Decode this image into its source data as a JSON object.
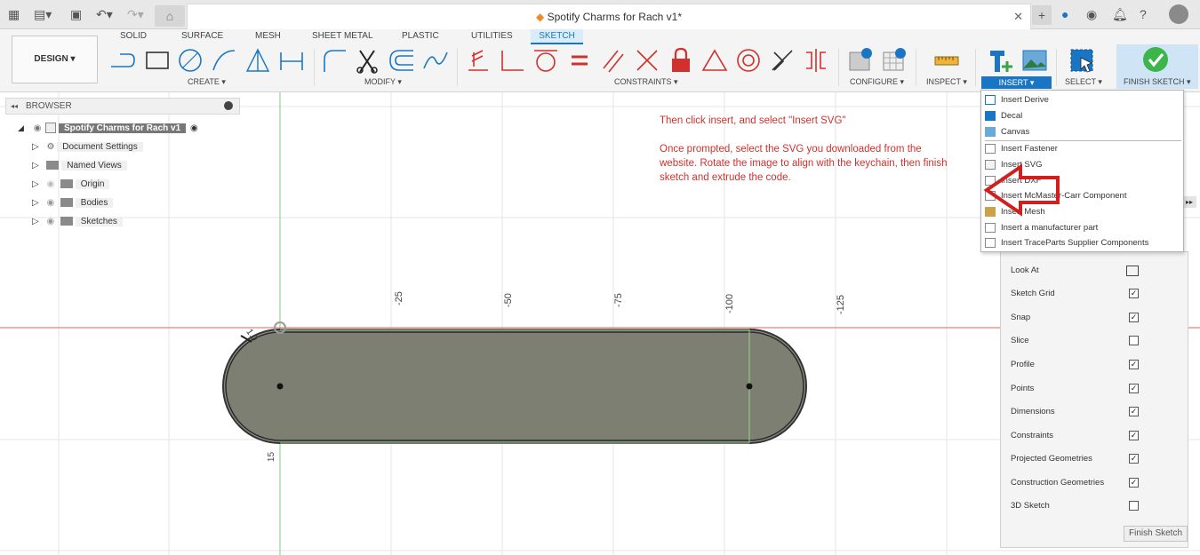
{
  "title_bar": {
    "doc_title": "Spotify Charms for Rach v1*"
  },
  "ribbon": {
    "workspace_label": "DESIGN ▾",
    "tabs": [
      "SOLID",
      "SURFACE",
      "MESH",
      "SHEET METAL",
      "PLASTIC",
      "UTILITIES",
      "SKETCH"
    ],
    "groups": {
      "create": "CREATE ▾",
      "modify": "MODIFY ▾",
      "constraints": "CONSTRAINTS ▾",
      "configure": "CONFIGURE ▾",
      "inspect": "INSPECT ▾",
      "insert": "INSERT ▾",
      "select": "SELECT ▾",
      "finish_sketch": "FINISH SKETCH ▾"
    }
  },
  "browser": {
    "header": "BROWSER",
    "root": "Spotify Charms for Rach v1",
    "items": [
      {
        "label": "Document Settings",
        "icon": "gear-icon"
      },
      {
        "label": "Named Views",
        "icon": "folder-icon"
      },
      {
        "label": "Origin",
        "icon": "folder-icon"
      },
      {
        "label": "Bodies",
        "icon": "folder-icon"
      },
      {
        "label": "Sketches",
        "icon": "folder-icon"
      }
    ]
  },
  "annotation": {
    "line1": "Then click insert, and select \"Insert SVG\"",
    "line2": "Once prompted, select the SVG you downloaded from the website. Rotate the image to align with the keychain, then finish sketch and extrude the code."
  },
  "insert_menu": {
    "items": [
      "Insert Derive",
      "Decal",
      "Canvas",
      "Insert Fastener",
      "Insert SVG",
      "Insert DXF",
      "Insert McMaster-Carr Component",
      "Insert Mesh",
      "Insert a manufacturer part",
      "Insert TraceParts Supplier Components"
    ]
  },
  "sketch_palette": {
    "look_at": "Look At",
    "options": [
      {
        "label": "Sketch Grid",
        "checked": true
      },
      {
        "label": "Snap",
        "checked": true
      },
      {
        "label": "Slice",
        "checked": false
      },
      {
        "label": "Profile",
        "checked": true
      },
      {
        "label": "Points",
        "checked": true
      },
      {
        "label": "Dimensions",
        "checked": true
      },
      {
        "label": "Constraints",
        "checked": true
      },
      {
        "label": "Projected Geometries",
        "checked": true
      },
      {
        "label": "Construction Geometries",
        "checked": true
      },
      {
        "label": "3D Sketch",
        "checked": false
      }
    ],
    "finish_button": "Finish Sketch"
  },
  "canvas": {
    "ruler_labels": [
      "-25",
      "-50",
      "-75",
      "-100",
      "-125"
    ],
    "dim_label": "1.0",
    "side_label": "15"
  },
  "colors": {
    "accent": "#1a76c5",
    "annotation": "#d0312d",
    "profile_fill": "#7d7f73",
    "axis_red": "#e0625e",
    "axis_green": "#7fcf7f"
  }
}
